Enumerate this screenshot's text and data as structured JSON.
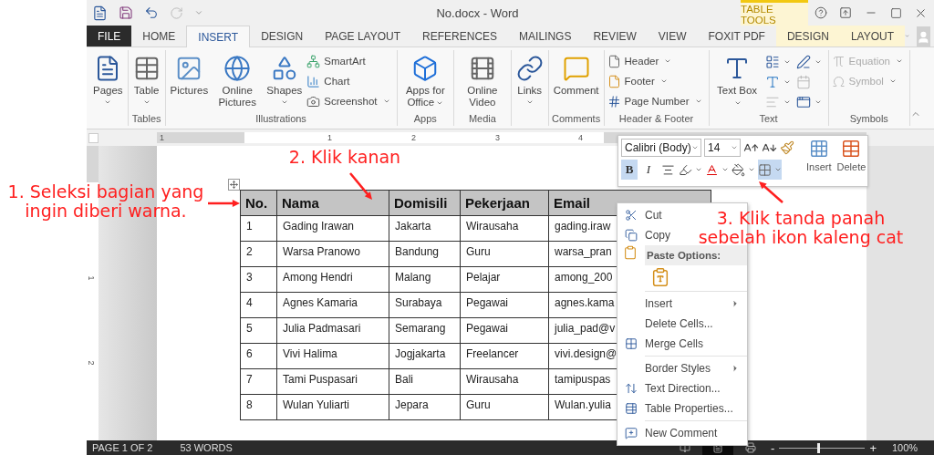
{
  "window": {
    "title": "No.docx - Word",
    "context_group": "TABLE TOOLS"
  },
  "tabs": [
    {
      "label": "FILE",
      "kind": "file",
      "selected": false
    },
    {
      "label": "HOME",
      "kind": "main",
      "selected": false
    },
    {
      "label": "INSERT",
      "kind": "main",
      "selected": true
    },
    {
      "label": "DESIGN",
      "kind": "main",
      "selected": false
    },
    {
      "label": "PAGE LAYOUT",
      "kind": "main",
      "selected": false
    },
    {
      "label": "REFERENCES",
      "kind": "main",
      "selected": false
    },
    {
      "label": "MAILINGS",
      "kind": "main",
      "selected": false
    },
    {
      "label": "REVIEW",
      "kind": "main",
      "selected": false
    },
    {
      "label": "VIEW",
      "kind": "main",
      "selected": false
    },
    {
      "label": "FOXIT PDF",
      "kind": "main",
      "selected": false
    },
    {
      "label": "DESIGN",
      "kind": "context",
      "selected": false
    },
    {
      "label": "LAYOUT",
      "kind": "context",
      "selected": false
    }
  ],
  "ribbon_groups": [
    {
      "buttons": [
        {
          "label": "Pages",
          "kind": "large",
          "dropdown": true,
          "caret_below": true
        }
      ]
    },
    {
      "label": "Tables",
      "buttons": [
        {
          "label": "Table",
          "kind": "large",
          "dropdown": true,
          "caret_below": true
        }
      ]
    },
    {
      "label": "Illustrations",
      "buttons": [
        {
          "label": "Pictures",
          "kind": "large"
        },
        {
          "label": "Online Pictures",
          "kind": "large"
        },
        {
          "label": "Shapes",
          "kind": "large",
          "dropdown": true,
          "caret_below": true
        },
        {
          "label": "SmartArt",
          "kind": "small"
        },
        {
          "label": "Chart",
          "kind": "small"
        },
        {
          "label": "Screenshot",
          "kind": "small",
          "dropdown": true
        }
      ]
    },
    {
      "label": "Apps",
      "buttons": [
        {
          "label": "Apps for Office",
          "kind": "large",
          "dropdown": true
        }
      ]
    },
    {
      "label": "Media",
      "buttons": [
        {
          "label": "Online Video",
          "kind": "large"
        }
      ]
    },
    {
      "buttons": [
        {
          "label": "Links",
          "kind": "large",
          "dropdown": true,
          "caret_below": true
        }
      ]
    },
    {
      "label": "Comments",
      "buttons": [
        {
          "label": "Comment",
          "kind": "large"
        }
      ]
    },
    {
      "label": "Header & Footer",
      "buttons": [
        {
          "label": "Header",
          "kind": "small",
          "dropdown": true
        },
        {
          "label": "Footer",
          "kind": "small",
          "dropdown": true
        },
        {
          "label": "Page Number",
          "kind": "small",
          "dropdown": true
        }
      ]
    },
    {
      "label": "Text",
      "buttons": [
        {
          "label": "Text Box",
          "kind": "large",
          "dropdown": true
        },
        {
          "kind": "icon",
          "dropdown": true,
          "disabled": false
        },
        {
          "kind": "icon",
          "dropdown": true,
          "disabled": false
        },
        {
          "kind": "icon",
          "dropdown": true,
          "disabled": false
        },
        {
          "kind": "icon",
          "disabled": true
        },
        {
          "kind": "icon",
          "dropdown": true,
          "disabled": true
        },
        {
          "kind": "icon",
          "dropdown": true,
          "disabled": false
        }
      ]
    },
    {
      "label": "Symbols",
      "buttons": [
        {
          "label": "Equation",
          "kind": "small",
          "dropdown": true,
          "disabled": true
        },
        {
          "label": "Symbol",
          "kind": "small",
          "dropdown": true,
          "disabled": true
        }
      ]
    }
  ],
  "ruler": {
    "h_numbers": [
      "1",
      "1",
      "2",
      "3",
      "4"
    ],
    "v_numbers": [
      "1",
      "2"
    ]
  },
  "table": {
    "header_selected": true,
    "columns": [
      "No.",
      "Nama",
      "Domisili",
      "Pekerjaan",
      "Email"
    ],
    "rows": [
      [
        "1",
        "Gading Irawan",
        "Jakarta",
        "Wirausaha",
        "gading.iraw"
      ],
      [
        "2",
        "Warsa Pranowo",
        "Bandung",
        "Guru",
        "warsa_pran"
      ],
      [
        "3",
        "Among Hendri",
        "Malang",
        "Pelajar",
        "among_200"
      ],
      [
        "4",
        "Agnes Kamaria",
        "Surabaya",
        "Pegawai",
        "agnes.kama"
      ],
      [
        "5",
        "Julia Padmasari",
        "Semarang",
        "Pegawai",
        "julia_pad@v"
      ],
      [
        "6",
        "Vivi Halima",
        "Jogjakarta",
        "Freelancer",
        "vivi.design@"
      ],
      [
        "7",
        "Tami Puspasari",
        "Bali",
        "Wirausaha",
        "tamipuspas"
      ],
      [
        "8",
        "Wulan Yuliarti",
        "Jepara",
        "Guru",
        "Wulan.yulia"
      ]
    ]
  },
  "mini_toolbar": {
    "font": "Calibri (Body)",
    "size": "14",
    "buttons": [
      {
        "label": "B",
        "kind": "bold",
        "selected": true
      },
      {
        "label": "I",
        "kind": "italic",
        "selected": false
      },
      {
        "kind": "align",
        "selected": false
      },
      {
        "kind": "highlight",
        "selected": false
      },
      {
        "kind": "font_color",
        "selected": false
      },
      {
        "kind": "shading",
        "selected": false
      },
      {
        "kind": "borders",
        "selected": true
      }
    ],
    "actions": [
      {
        "label": "Insert"
      },
      {
        "label": "Delete"
      }
    ]
  },
  "context_menu": [
    {
      "kind": "item",
      "label": "Cut"
    },
    {
      "kind": "item",
      "label": "Copy"
    },
    {
      "kind": "header",
      "label": "Paste Options:"
    },
    {
      "kind": "paste"
    },
    {
      "kind": "separator"
    },
    {
      "kind": "item",
      "label": "Insert",
      "submenu": true
    },
    {
      "kind": "item",
      "label": "Delete Cells..."
    },
    {
      "kind": "item",
      "label": "Merge Cells"
    },
    {
      "kind": "separator"
    },
    {
      "kind": "item",
      "label": "Border Styles",
      "submenu": true
    },
    {
      "kind": "item",
      "label": "Text Direction..."
    },
    {
      "kind": "item",
      "label": "Table Properties..."
    },
    {
      "kind": "separator"
    },
    {
      "kind": "item",
      "label": "New Comment"
    }
  ],
  "status_bar": {
    "page": "PAGE 1 OF 2",
    "words": "53 WORDS",
    "views": [
      {
        "selected": false
      },
      {
        "selected": true
      },
      {
        "selected": false
      }
    ],
    "zoom_out": "-",
    "zoom_in": "+",
    "zoom": {
      "level": 0.45
    },
    "zoom_label": "100%"
  },
  "annotations": [
    {
      "text": "1. Seleksi bagian yang ingin diberi warna."
    },
    {
      "text": "2. Klik kanan"
    },
    {
      "text": "3. Klik tanda panah sebelah ikon kaleng cat"
    }
  ]
}
